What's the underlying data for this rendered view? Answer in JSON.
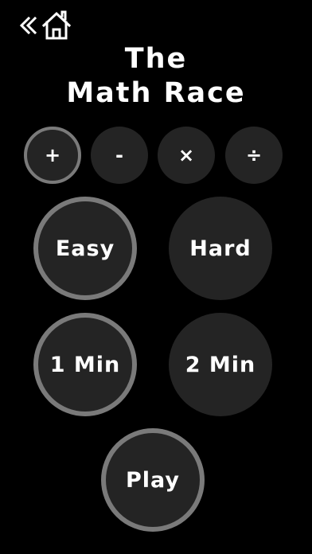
{
  "header": {
    "home_icon": "home-icon",
    "back_icon": "double-chevron-left-icon",
    "title_line1": "The",
    "title_line2": "Math Race"
  },
  "operations": {
    "add": "+",
    "subtract": "-",
    "multiply": "×",
    "divide": "÷",
    "selected": "+"
  },
  "difficulty": {
    "easy": "Easy",
    "hard": "Hard",
    "selected": "Easy"
  },
  "duration": {
    "one_min": "1 Min",
    "two_min": "2 Min",
    "selected": "1 Min"
  },
  "play_label": "Play",
  "colors": {
    "background": "#000000",
    "button_fill": "#242424",
    "selected_ring": "#7a7a7a",
    "text": "#ffffff"
  }
}
